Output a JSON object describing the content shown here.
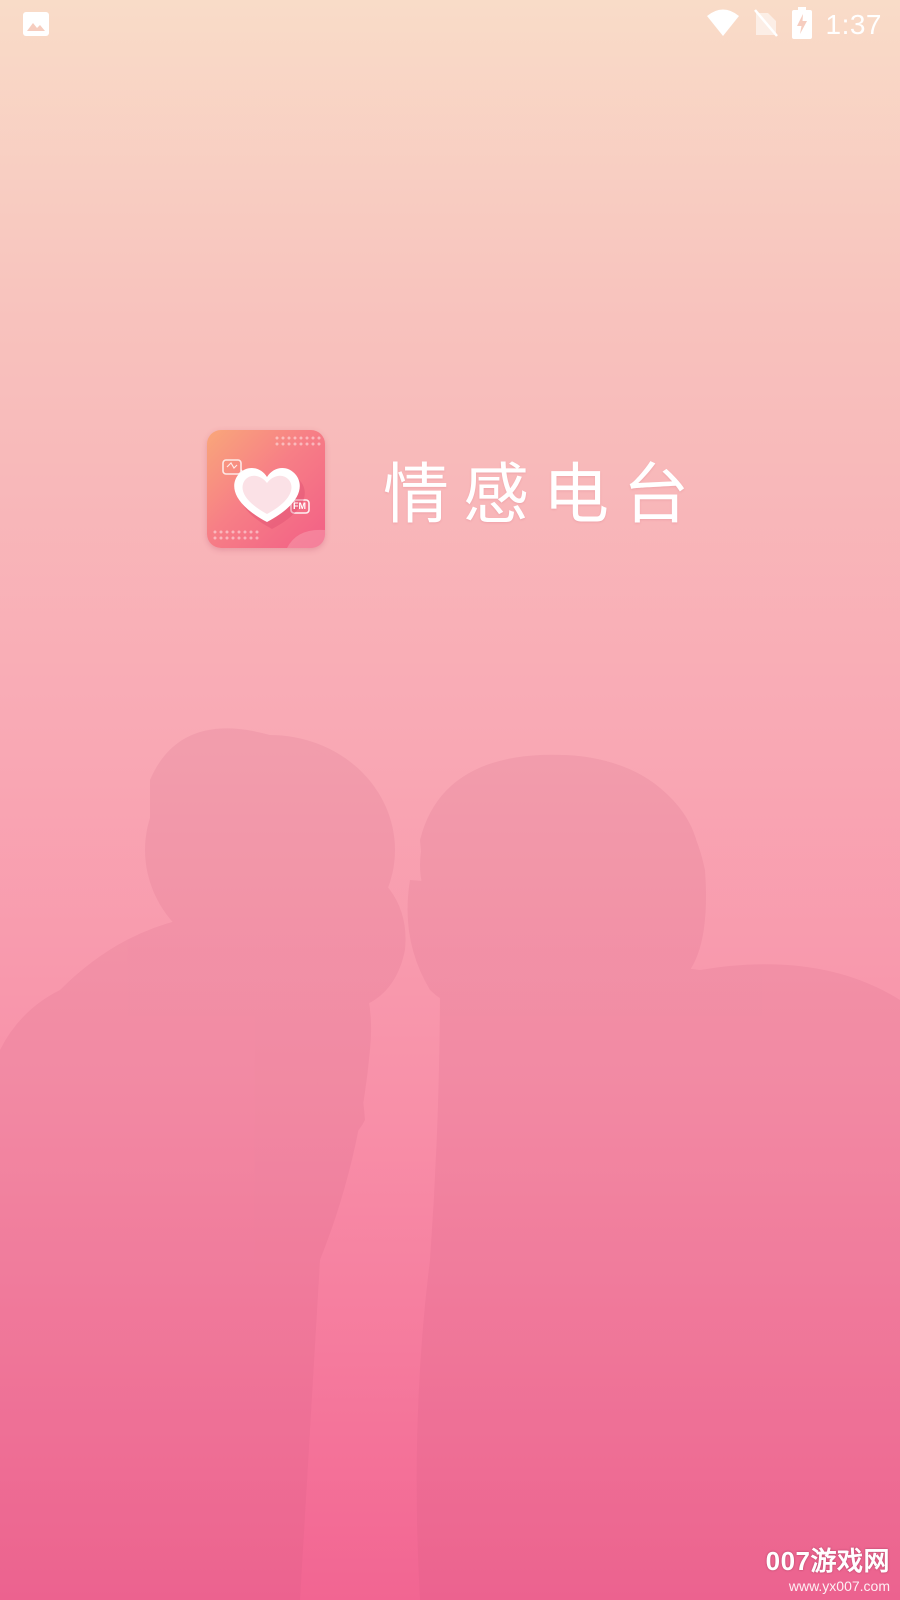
{
  "status_bar": {
    "time": "1:37",
    "icons": [
      "image-icon",
      "wifi-icon",
      "no-sim-icon",
      "battery-charging-icon"
    ]
  },
  "splash": {
    "app_name": "情感电台",
    "icon": "heart-fm-icon",
    "icon_badge": "FM"
  },
  "watermark": {
    "main": "007游戏网",
    "sub": "www.yx007.com"
  },
  "colors": {
    "gradient_top": "#f9dcc8",
    "gradient_bottom": "#f26592",
    "text": "#ffffff"
  }
}
